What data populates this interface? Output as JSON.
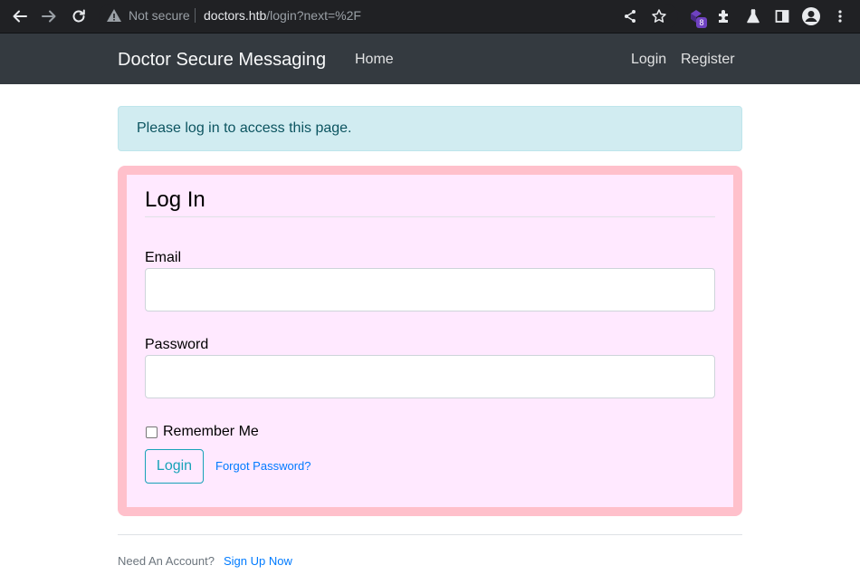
{
  "browser": {
    "security_label": "Not secure",
    "url_host": "doctors.htb",
    "url_path": "/login?next=%2F",
    "extension_badge": "8",
    "colors": {
      "toolbar": "#202124",
      "text": "#e8eaed",
      "muted": "#9aa0a6"
    }
  },
  "navbar": {
    "brand": "Doctor Secure Messaging",
    "home": "Home",
    "login": "Login",
    "register": "Register"
  },
  "alert": {
    "message": "Please log in to access this page."
  },
  "form": {
    "legend": "Log In",
    "email_label": "Email",
    "email_value": "",
    "password_label": "Password",
    "password_value": "",
    "remember_label": "Remember Me",
    "remember_checked": false,
    "submit_label": "Login",
    "forgot_label": "Forgot Password?"
  },
  "footer": {
    "prompt": "Need An Account?",
    "signup_link": "Sign Up Now"
  },
  "theme": {
    "card_background": "#ffe9ff",
    "card_border": "#ffc0cb",
    "navbar_background": "#343a40",
    "alert_background": "#d1ecf1",
    "alert_text": "#0c5460",
    "accent": "#17a2b8",
    "link": "#007bff"
  }
}
